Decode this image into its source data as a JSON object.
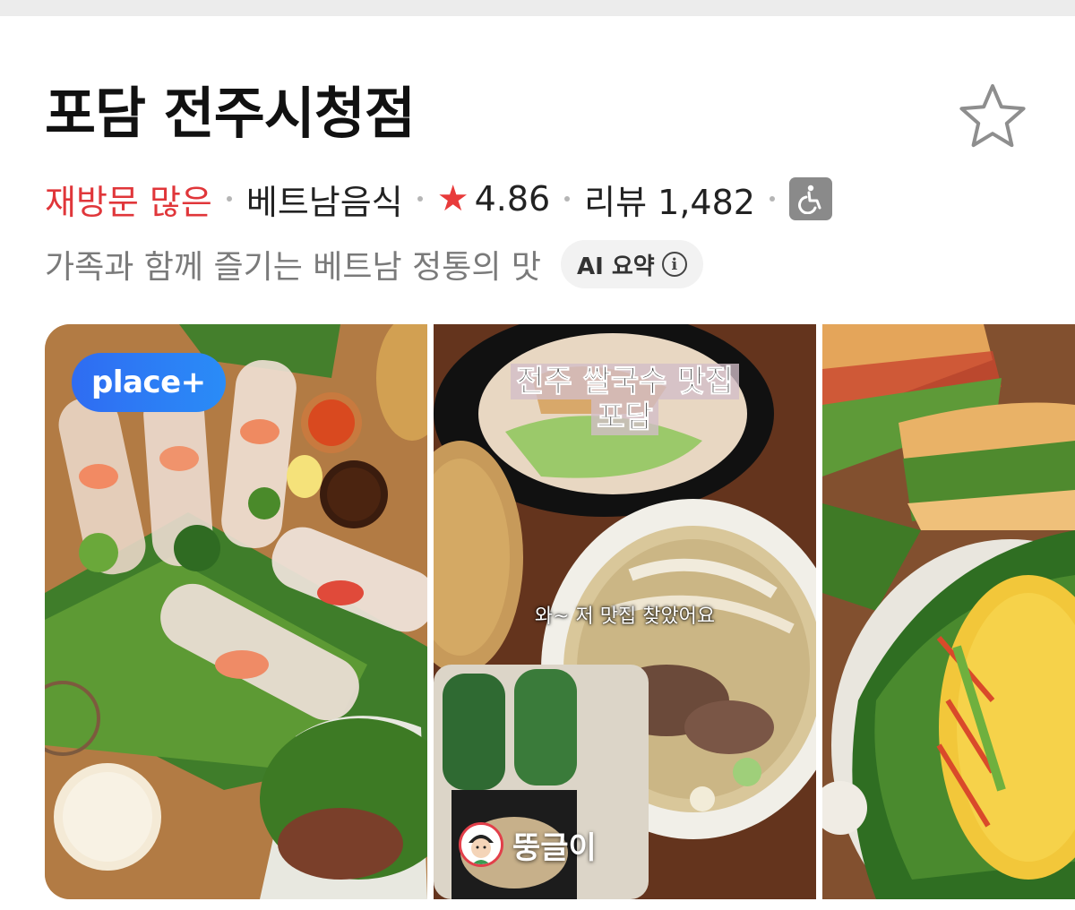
{
  "place": {
    "name": "포담 전주시청점",
    "tag": "재방문 많은",
    "category": "베트남음식",
    "rating": "4.86",
    "reviews_label": "리뷰 1,482",
    "description": "가족과 함께 즐기는 베트남 정통의 맛",
    "ai_chip_label": "AI 요약",
    "info_glyph": "i"
  },
  "icons": {
    "favorite": "star-outline-icon",
    "rating": "star-filled-icon",
    "accessibility": "wheelchair-icon",
    "info": "info-icon"
  },
  "colors": {
    "tag": "#e0363a",
    "rating_star": "#e83a3a",
    "badge": "#2f6cf2",
    "muted": "#7a7a7a"
  },
  "gallery": {
    "photo1": {
      "badge": "place+"
    },
    "photo2": {
      "caption_line1": "전주 쌀국수 맛집",
      "caption_line2": "포담",
      "subtitle": "와~ 저 맛집 찾았어요",
      "author": "뚱글이"
    },
    "photo3": {}
  }
}
